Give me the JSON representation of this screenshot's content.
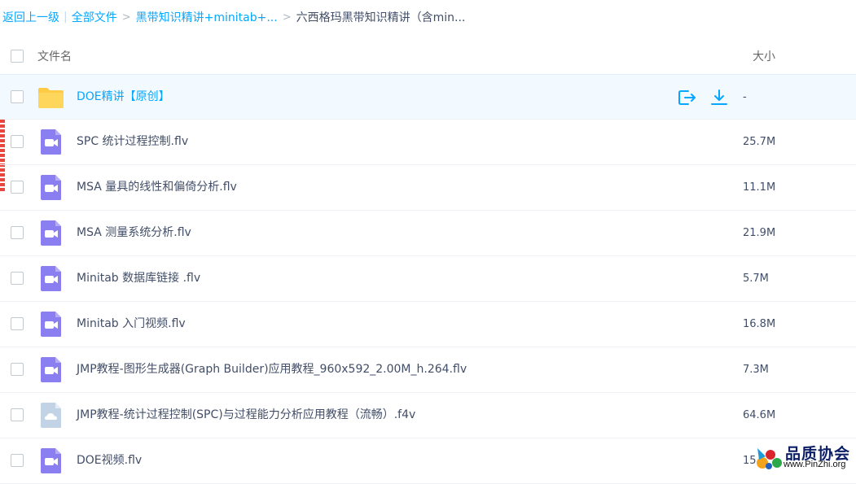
{
  "breadcrumb": {
    "back": "返回上一级",
    "all_files": "全部文件",
    "parent": "黑带知识精讲+minitab+...",
    "current": "六西格玛黑带知识精讲（含min..."
  },
  "header": {
    "name_label": "文件名",
    "size_label": "大小"
  },
  "files": [
    {
      "name": "DOE精讲【原创】",
      "size": "-",
      "type": "folder-icon"
    },
    {
      "name": "SPC 统计过程控制.flv",
      "size": "25.7M",
      "type": "video-icon"
    },
    {
      "name": "MSA 量具的线性和偏倚分析.flv",
      "size": "11.1M",
      "type": "video-icon"
    },
    {
      "name": "MSA 测量系统分析.flv",
      "size": "21.9M",
      "type": "video-icon"
    },
    {
      "name": "Minitab 数据库链接 .flv",
      "size": "5.7M",
      "type": "video-icon"
    },
    {
      "name": "Minitab 入门视频.flv",
      "size": "16.8M",
      "type": "video-icon"
    },
    {
      "name": "JMP教程-图形生成器(Graph Builder)应用教程_960x592_2.00M_h.264.flv",
      "size": "7.3M",
      "type": "video-icon"
    },
    {
      "name": "JMP教程-统计过程控制(SPC)与过程能力分析应用教程（流畅）.f4v",
      "size": "64.6M",
      "type": "cloud-file-icon"
    },
    {
      "name": "DOE视频.flv",
      "size": "15.",
      "type": "video-icon"
    }
  ],
  "row_actions": [
    "share-icon",
    "download-icon"
  ],
  "watermark": {
    "title": "品质协会",
    "url": "www.PinZhi.org"
  },
  "colors": {
    "accent": "#06a7ff",
    "video_icon": "#8a7ef0",
    "folder": "#ffcb45",
    "highlight_row": "#f2f9ff"
  }
}
